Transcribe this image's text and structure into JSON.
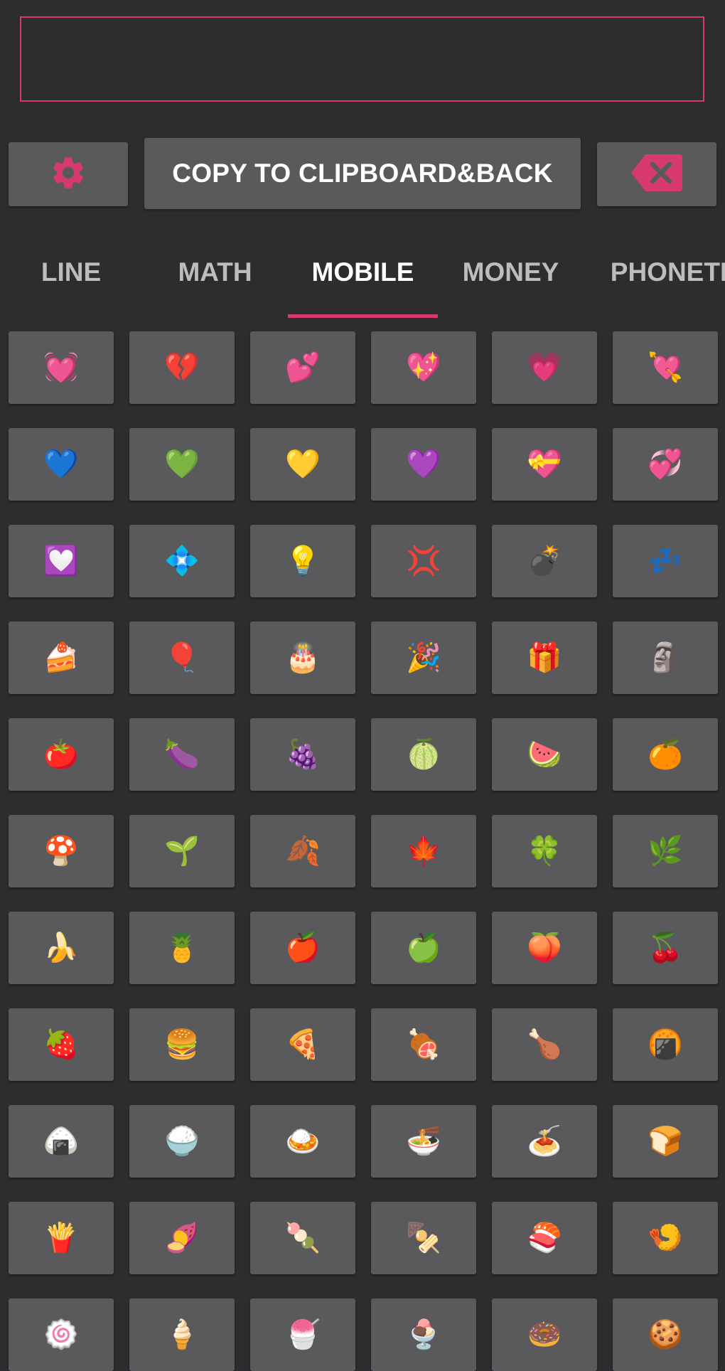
{
  "input": {
    "value": "",
    "placeholder": ""
  },
  "toolbar": {
    "settings_icon": "gear-icon",
    "copy_label": "COPY TO CLIPBOARD&BACK",
    "delete_icon": "backspace-icon"
  },
  "colors": {
    "background": "#2d2d30",
    "button": "#5a5a5c",
    "accent": "#d63a6e",
    "tab_inactive": "#bdbdbd",
    "tab_active": "#ffffff"
  },
  "tabs": [
    {
      "label": "LINE",
      "active": false
    },
    {
      "label": "MATH",
      "active": false
    },
    {
      "label": "MOBILE",
      "active": true
    },
    {
      "label": "MONEY",
      "active": false
    },
    {
      "label": "PHONETI",
      "active": false
    }
  ],
  "emoji_grid": [
    [
      "💓",
      "💔",
      "💕",
      "💖",
      "💗",
      "💘"
    ],
    [
      "💙",
      "💚",
      "💛",
      "💜",
      "💝",
      "💞"
    ],
    [
      "💟",
      "💠",
      "💡",
      "💢",
      "💣",
      "💤"
    ],
    [
      "🍰",
      "🎈",
      "🎂",
      "🎉",
      "🎁",
      "🗿"
    ],
    [
      "🍅",
      "🍆",
      "🍇",
      "🍈",
      "🍉",
      "🍊"
    ],
    [
      "🍄",
      "🌱",
      "🍂",
      "🍁",
      "🍀",
      "🌿"
    ],
    [
      "🍌",
      "🍍",
      "🍎",
      "🍏",
      "🍑",
      "🍒"
    ],
    [
      "🍓",
      "🍔",
      "🍕",
      "🍖",
      "🍗",
      "🍘"
    ],
    [
      "🍙",
      "🍚",
      "🍛",
      "🍜",
      "🍝",
      "🍞"
    ],
    [
      "🍟",
      "🍠",
      "🍡",
      "🍢",
      "🍣",
      "🍤"
    ],
    [
      "🍥",
      "🍦",
      "🍧",
      "🍨",
      "🍩",
      "🍪"
    ]
  ]
}
